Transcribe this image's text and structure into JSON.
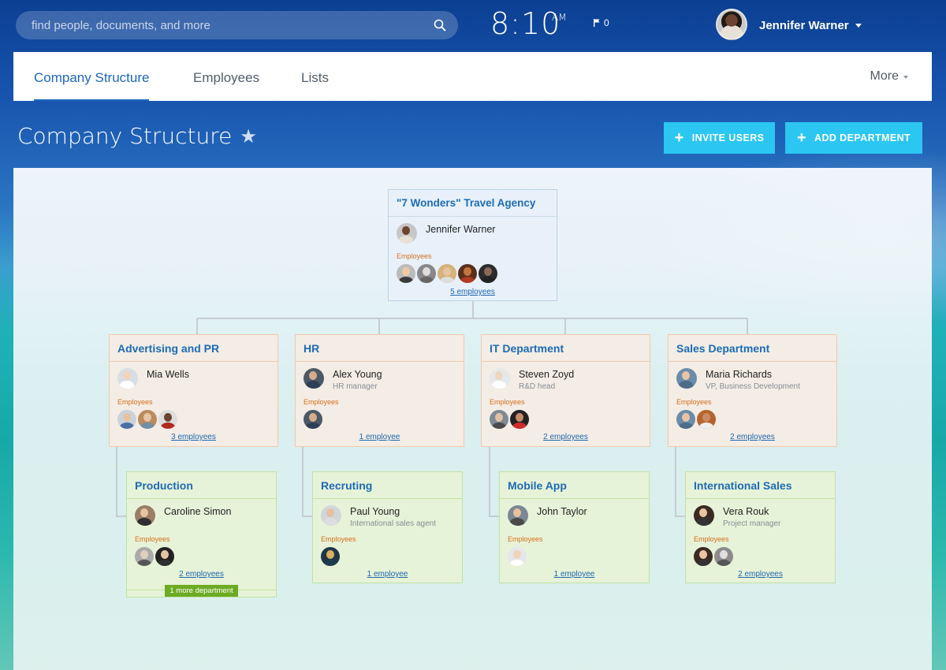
{
  "search": {
    "placeholder": "find people, documents, and more"
  },
  "clock": {
    "time": "8:10",
    "ampm": "AM"
  },
  "flag_count": "0",
  "user": {
    "name": "Jennifer Warner"
  },
  "tabs": [
    {
      "label": "Company Structure",
      "active": true
    },
    {
      "label": "Employees",
      "active": false
    },
    {
      "label": "Lists",
      "active": false
    }
  ],
  "more_label": "More",
  "page_title": "Company Structure",
  "buttons": {
    "invite": "INVITE USERS",
    "add_department": "ADD DEPARTMENT"
  },
  "colors": {
    "accent": "#1d65c1",
    "button": "#2bc6f2",
    "root_card": "#e8f1fa",
    "dept_card": "#f3ede5",
    "sub_card": "#e7f3d8",
    "more_badge": "#6dab23"
  },
  "root": {
    "title": "\"7 Wonders\" Travel Agency",
    "head_name": "Jennifer Warner",
    "employees_label": "Employees",
    "employees_count": "5 employees"
  },
  "departments": [
    {
      "title": "Advertising and PR",
      "head_name": "Mia Wells",
      "head_role": "",
      "employees_label": "Employees",
      "employees_count": "3 employees"
    },
    {
      "title": "HR",
      "head_name": "Alex Young",
      "head_role": "HR manager",
      "employees_label": "Employees",
      "employees_count": "1 employee"
    },
    {
      "title": "IT Department",
      "head_name": "Steven Zoyd",
      "head_role": "R&D head",
      "employees_label": "Employees",
      "employees_count": "2 employees"
    },
    {
      "title": "Sales Department",
      "head_name": "Maria Richards",
      "head_role": "VP, Business Development",
      "employees_label": "Employees",
      "employees_count": "2 employees"
    }
  ],
  "subdepartments": [
    {
      "title": "Production",
      "head_name": "Caroline Simon",
      "head_role": "",
      "employees_label": "Employees",
      "employees_count": "2 employees",
      "more_departments": "1 more department"
    },
    {
      "title": "Recruting",
      "head_name": "Paul Young",
      "head_role": "International sales agent",
      "employees_label": "Employees",
      "employees_count": "1 employee"
    },
    {
      "title": "Mobile App",
      "head_name": "John Taylor",
      "head_role": "",
      "employees_label": "Employees",
      "employees_count": "1 employee"
    },
    {
      "title": "International Sales",
      "head_name": "Vera Rouk",
      "head_role": "Project manager",
      "employees_label": "Employees",
      "employees_count": "2 employees"
    }
  ]
}
